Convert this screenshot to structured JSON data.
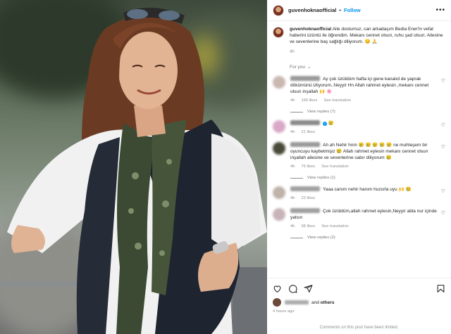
{
  "post": {
    "username": "guvenhoknaofficial",
    "dot": "•",
    "follow_label": "Follow",
    "more_label": "•••"
  },
  "caption": {
    "username": "guvenhoknaofficial",
    "text": "Aile dostumuz, can arkadaşım Bedia Ener'in vefat haberini üzüntü ile öğrendim. Mekanı cennet olsun, ruhu şad olsun. Ailesine ve sevenlerine baş sağlığı diliyorum. 😔 🙏",
    "time": "4h"
  },
  "for_you": {
    "label": "For you",
    "chevron": "⌄"
  },
  "comments": [
    {
      "text": "Ay çok üzüldüm hafta içi gene kanalıd de yaprak dökümünü izliyorum..Neyyir Hn Allah rahmet eylesin ,mekanı cennet olsun inşallah 🙌 🌸",
      "time": "4h",
      "likes": "166 likes",
      "translation": "See translation",
      "replies": "View replies (7)",
      "avatar_color": "#c9b7b0",
      "name_color": "#9a9a9a",
      "verified": false
    },
    {
      "text": "😢",
      "time": "4h",
      "likes": "21 likes",
      "translation": "",
      "replies": "",
      "avatar_color": "#d9a9c7",
      "name_color": "#8a8a8a",
      "verified": true
    },
    {
      "text": "Ah ah Nehir hnm 😢 😢 😢 😢 😢 ne muhteşem bir oyuncuyu kaybetmişiz 😢 Allah rahmet eylesin mekanı cennet olsun inşallah ailesine ve sevenlerine sabır diliyorum 😢",
      "time": "4h",
      "likes": "76 likes",
      "translation": "See translation",
      "replies": "View replies (1)",
      "avatar_color": "#4a4a3a",
      "name_color": "#9a9a9a",
      "verified": false
    },
    {
      "text": "Yaaa canım nehir hanım huzurla uyu 🙌 😢",
      "time": "4h",
      "likes": "23 likes",
      "translation": "",
      "replies": "",
      "avatar_color": "#bfb2a8",
      "name_color": "#a0a0a0",
      "verified": false
    },
    {
      "text": "Çok üzüldüm,allah rahmet eylesin,Neyyir abla nur içinde yatsın",
      "time": "4h",
      "likes": "58 likes",
      "translation": "See translation",
      "replies": "View replies (2)",
      "avatar_color": "#c7b3b8",
      "name_color": "#a0a0a0",
      "verified": false
    }
  ],
  "actions": {
    "liked_by_suffix": "and",
    "others": "others",
    "post_time": "4 hours ago",
    "limited_text": "Comments on this post have been limited."
  },
  "icons": [
    "more-icon",
    "heart-icon",
    "comment-icon",
    "share-icon",
    "bookmark-icon"
  ]
}
